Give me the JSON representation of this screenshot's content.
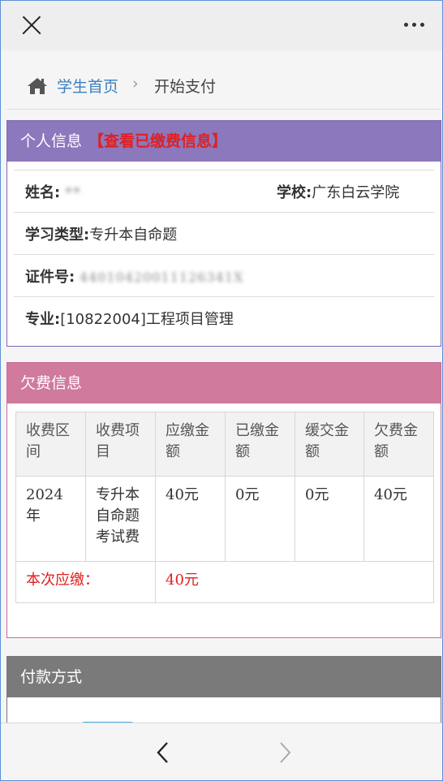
{
  "breadcrumb": {
    "home": "学生首页",
    "separator": "›",
    "current": "开始支付"
  },
  "personal": {
    "title": "个人信息",
    "view_link": "【查看已缴费信息】",
    "name_label": "姓名:",
    "name_value": "**",
    "school_label": "学校:",
    "school_value": "广东白云学院",
    "study_type_label": "学习类型:",
    "study_type_value": "专升本自命题",
    "id_label": "证件号:",
    "id_value": "44010420011126341X",
    "major_label": "专业:",
    "major_value": "[10822004]工程项目管理"
  },
  "arrears": {
    "title": "欠费信息",
    "headers": [
      "收费区间",
      "收费项目",
      "应缴金额",
      "已缴金额",
      "缓交金额",
      "欠费金额"
    ],
    "row": [
      "2024年",
      "专升本自命题考试费",
      "40元",
      "0元",
      "0元",
      "40元"
    ],
    "total_label": "本次应缴：",
    "total_value": "40元"
  },
  "payment": {
    "title": "付款方式"
  },
  "colors": {
    "personal_header": "#8c78bd",
    "arrears_header": "#d07a9e",
    "payment_header": "#7a7a7a",
    "link": "#3a7fc1",
    "alert": "#e02020"
  }
}
